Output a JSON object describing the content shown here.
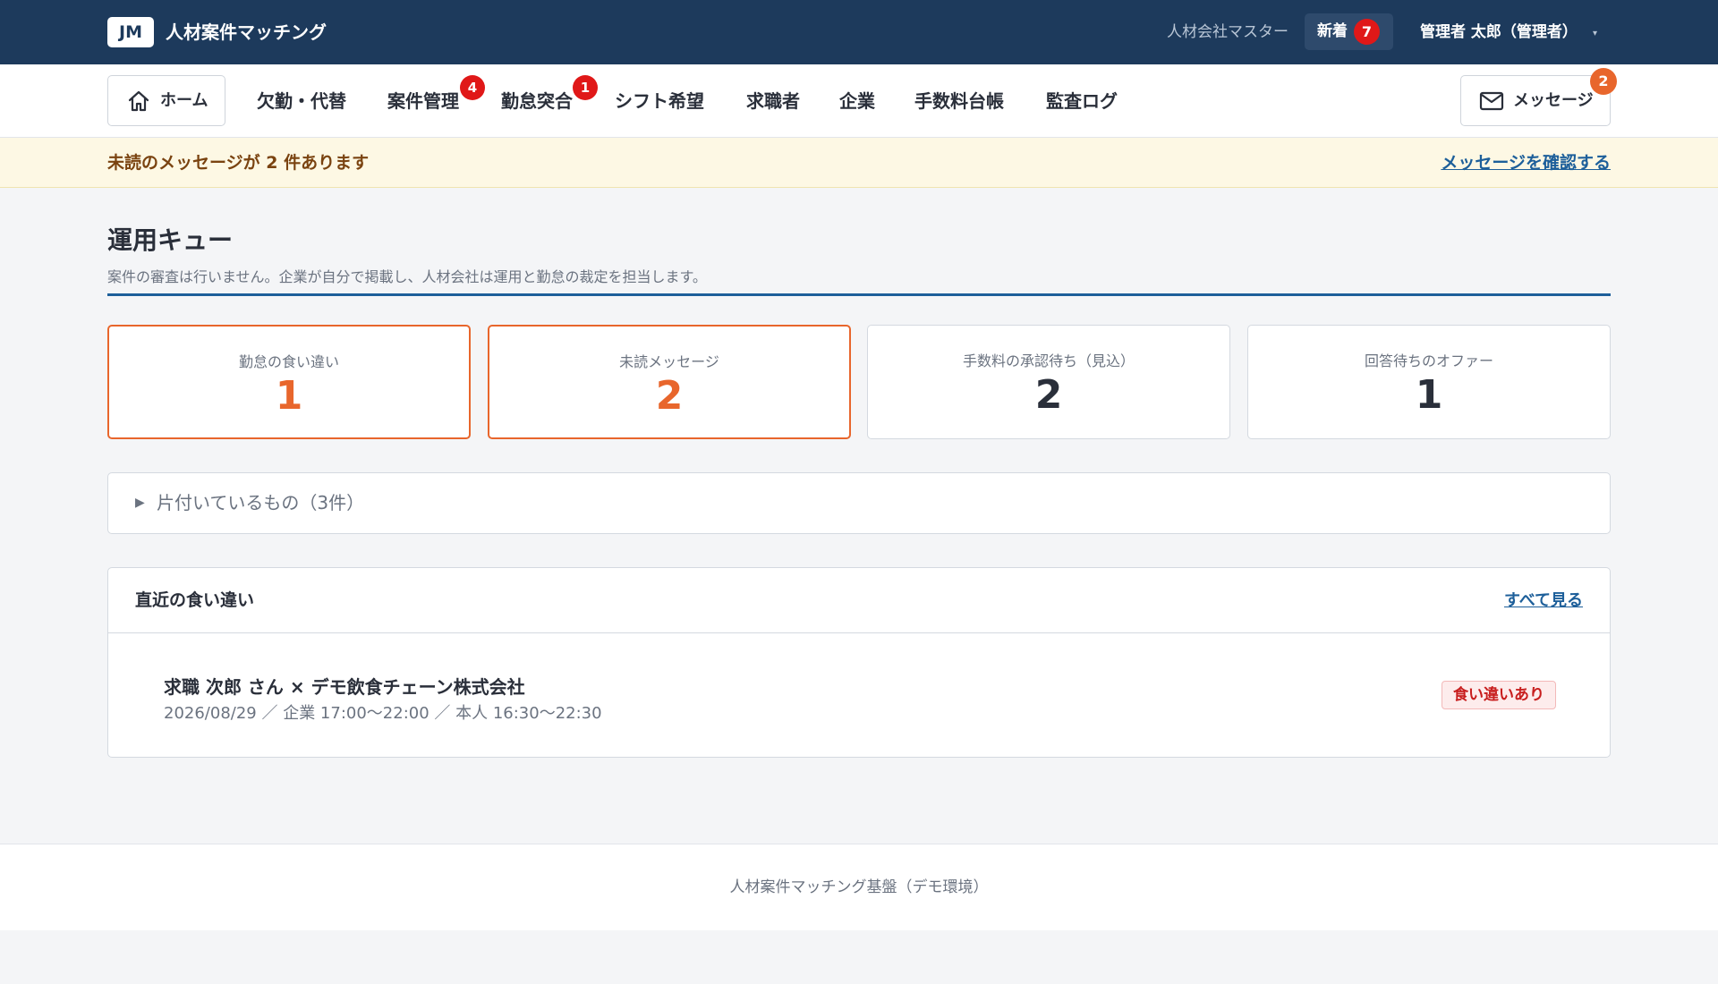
{
  "header": {
    "logo": "JM",
    "app_name": "人材案件マッチング",
    "org_name": "人材会社マスター",
    "new_label": "新着",
    "new_count": "7",
    "user_label": "管理者 太郎（管理者）",
    "user_caret": "▾"
  },
  "nav": {
    "home": "ホーム",
    "items": [
      {
        "label": "欠勤・代替"
      },
      {
        "label": "案件管理",
        "badge": "4"
      },
      {
        "label": "勤怠突合",
        "badge": "1"
      },
      {
        "label": "シフト希望"
      },
      {
        "label": "求職者"
      },
      {
        "label": "企業"
      },
      {
        "label": "手数料台帳"
      },
      {
        "label": "監査ログ"
      }
    ],
    "messages": "メッセージ",
    "messages_badge": "2"
  },
  "alert": {
    "text": "未読のメッセージが 2 件あります",
    "link": "メッセージを確認する"
  },
  "main": {
    "title": "運用キュー",
    "subtitle": "案件の審査は行いません。企業が自分で掲載し、人材会社は運用と勤怠の裁定を担当します。",
    "cards": [
      {
        "label": "勤怠の食い違い",
        "value": "1"
      },
      {
        "label": "未読メッセージ",
        "value": "2"
      },
      {
        "label": "手数料の承認待ち（見込）",
        "value": "2"
      },
      {
        "label": "回答待ちのオファー",
        "value": "1"
      }
    ],
    "collapsed_caret": "▶",
    "collapsed_label": "片付いているもの（3件）",
    "panel": {
      "title": "直近の食い違い",
      "link": "すべて見る",
      "row_title": "求職 次郎 さん × デモ飲食チェーン株式会社",
      "row_detail": "2026/08/29 ／ 企業 17:00〜22:00 ／ 本人 16:30〜22:30",
      "badge": "食い違いあり"
    }
  },
  "footer": {
    "text": "人材案件マッチング基盤（デモ環境）"
  },
  "colors": {
    "header_bg": "#1d3a5c",
    "accent_orange": "#e8662c",
    "badge_red": "#e01818",
    "link_blue": "#1d5f9a",
    "alert_bg": "#fdf8e4"
  }
}
